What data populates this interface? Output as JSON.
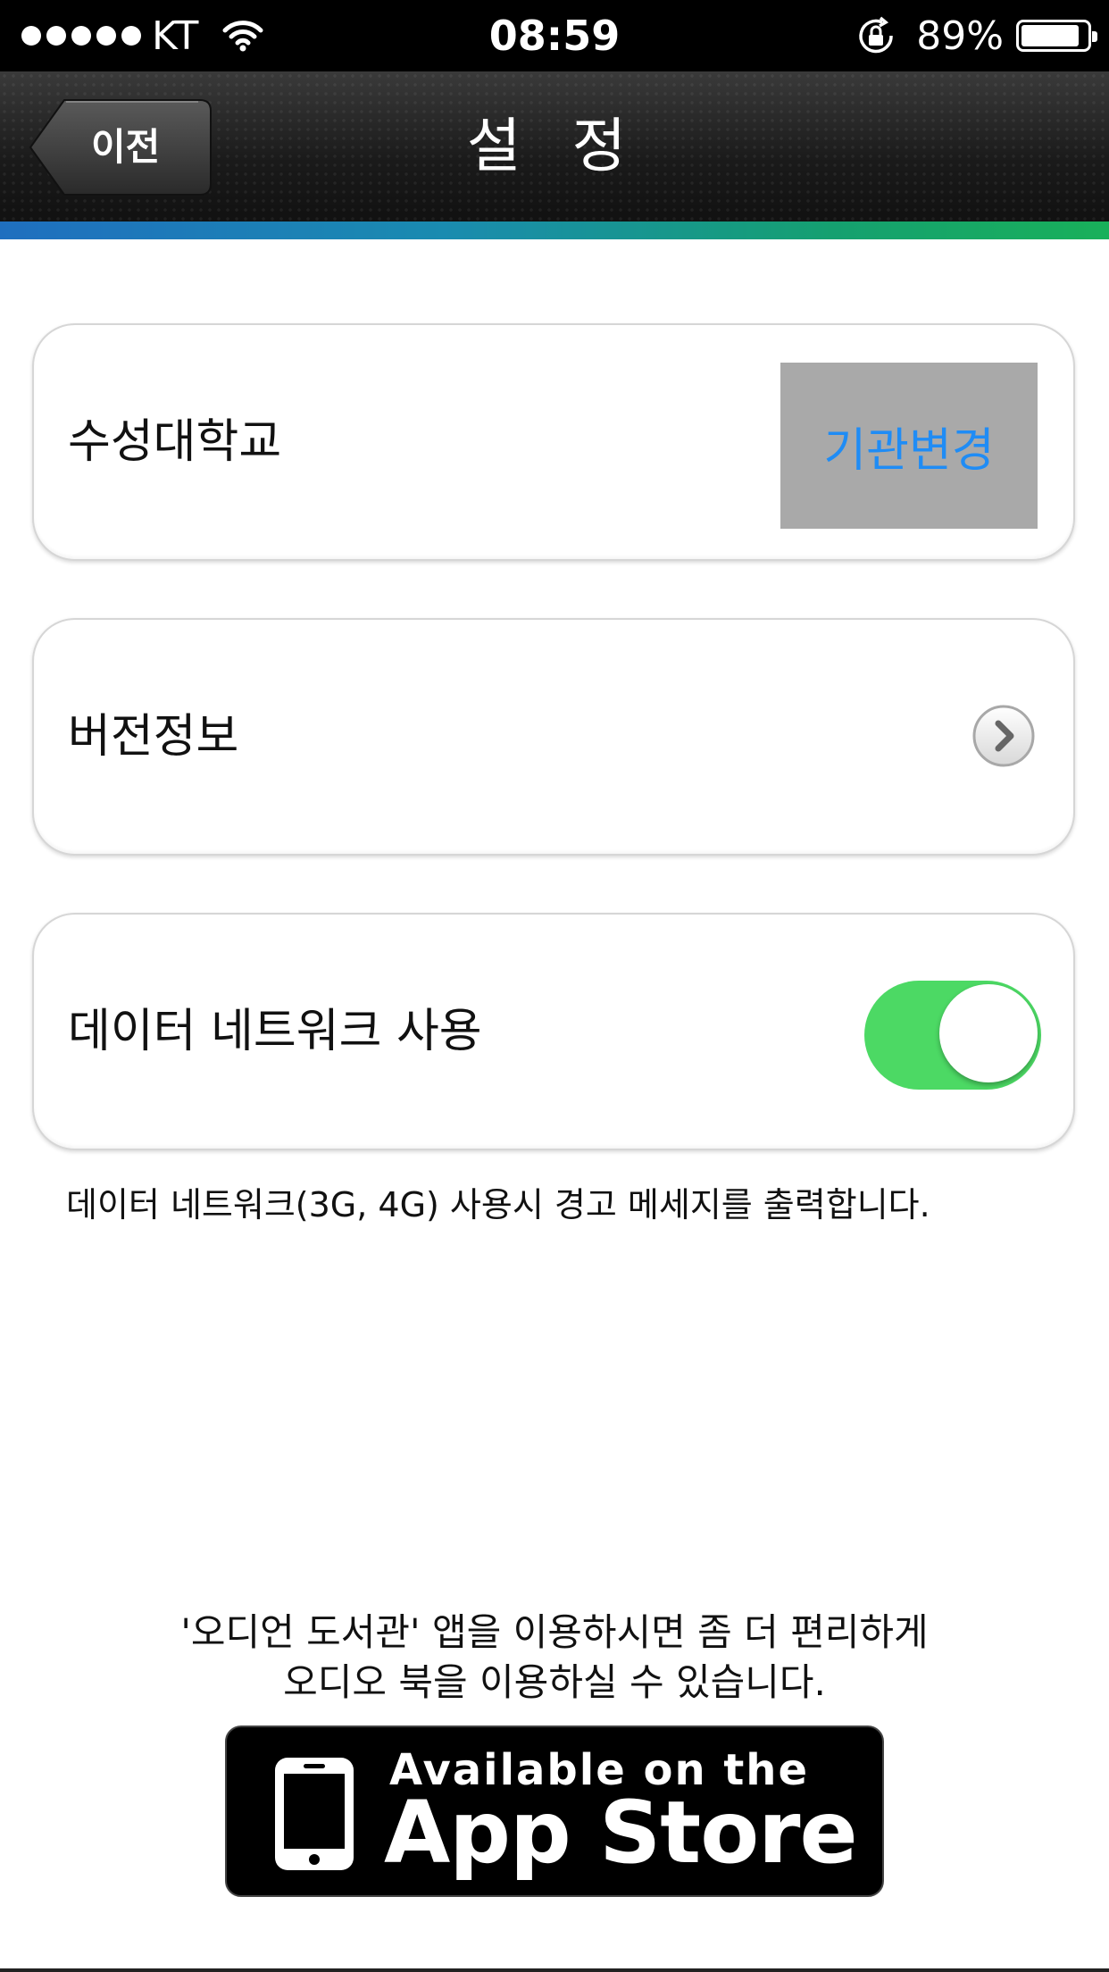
{
  "status_bar": {
    "carrier": "KT",
    "time": "08:59",
    "battery_percent": "89%",
    "battery_level": 0.89,
    "signal_icon": "signal-dots-icon",
    "wifi_icon": "wifi-icon",
    "rotation_lock_icon": "rotation-lock-icon"
  },
  "nav": {
    "back_label": "이전",
    "title": "설 정"
  },
  "settings": {
    "institution": {
      "label": "수성대학교",
      "button_label": "기관변경"
    },
    "version": {
      "label": "버전정보",
      "icon": "chevron-right-icon"
    },
    "data_network": {
      "label": "데이터 네트워크 사용",
      "enabled": true,
      "help": "데이터 네트워크(3G, 4G) 사용시 경고 메세지를 출력합니다."
    }
  },
  "promo": {
    "line1": "'오디언 도서관' 앱을 이용하시면 좀 더 편리하게",
    "line2": "오디오 북을 이용하실 수 있습니다.",
    "badge_line1": "Available on the",
    "badge_line2": "App Store"
  },
  "colors": {
    "accent_blue": "#1f8cf5",
    "toggle_green": "#4cd964",
    "change_button_bg": "#a9a9a9"
  }
}
